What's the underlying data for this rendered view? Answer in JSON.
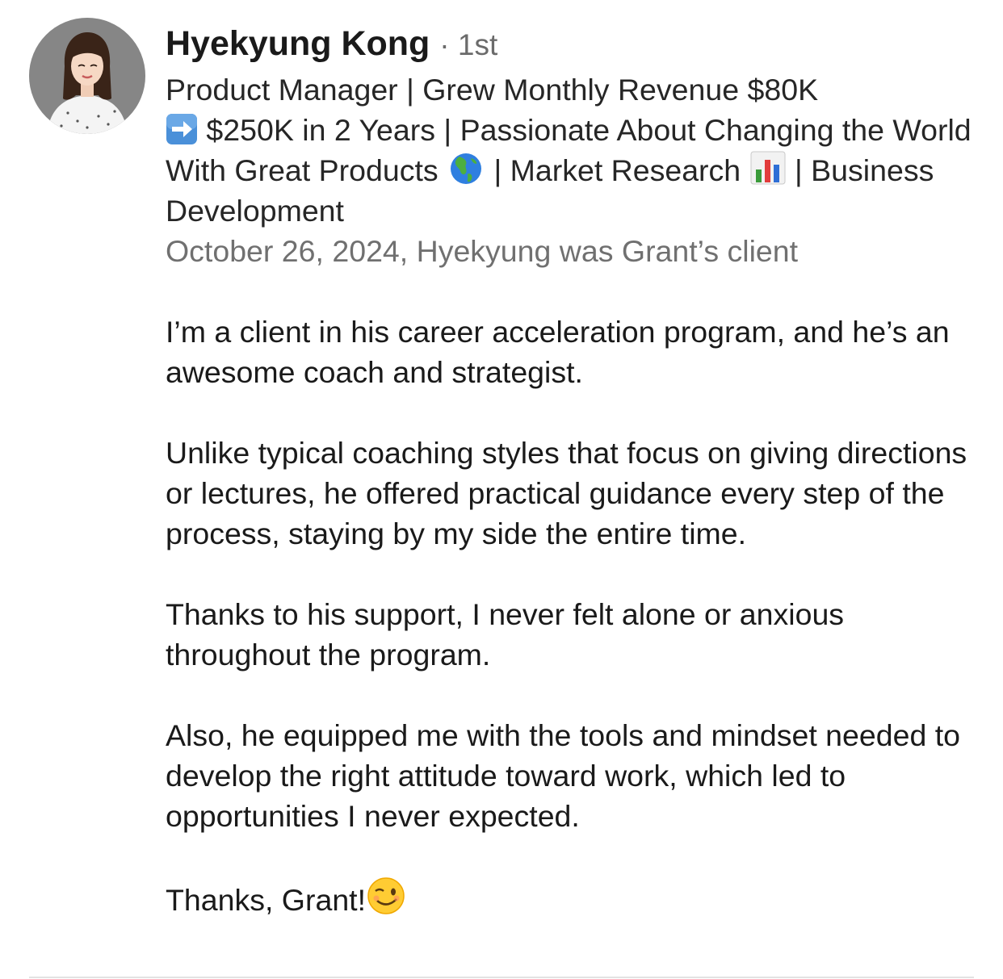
{
  "recommendation": {
    "author": {
      "name": "Hyekyung Kong",
      "connection_degree": "· 1st",
      "headline": {
        "part1": "Product Manager | Grew Monthly Revenue $80K",
        "part2": "$250K in 2 Years | Passionate About Changing the World With Great Products",
        "part3": "| Market Research",
        "part4": "| Business Development"
      },
      "avatar_icon": "profile-photo"
    },
    "meta": "October 26, 2024, Hyekyung was Grant’s client",
    "paragraphs": [
      "I’m a client in his career acceleration program, and he’s an awesome coach and strategist.",
      "Unlike typical coaching styles that focus on giving directions or lectures, he offered practical guidance every step of the process, staying by my side the entire time.",
      "Thanks to his support, I never felt alone or anxious throughout the program.",
      "Also, he equipped me with the tools and mindset needed to develop the right attitude toward work, which led to opportunities I never expected."
    ],
    "closing": "Thanks, Grant!",
    "emojis": [
      "right-arrow-emoji",
      "globe-americas-emoji",
      "bar-chart-emoji",
      "winking-face-emoji"
    ]
  }
}
